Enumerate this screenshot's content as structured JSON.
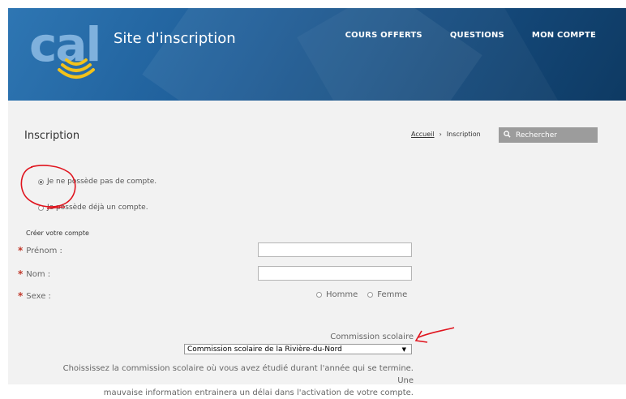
{
  "header": {
    "logo_text": "cal",
    "site_title": "Site d'inscription",
    "nav": [
      {
        "label": "COURS OFFERTS"
      },
      {
        "label": "QUESTIONS"
      },
      {
        "label": "MON COMPTE"
      }
    ]
  },
  "page": {
    "title": "Inscription",
    "breadcrumb": {
      "home": "Accueil",
      "separator": "›",
      "current": "Inscription"
    },
    "search_label": "Rechercher"
  },
  "account_choice": {
    "no_account": "Je ne possède pas de compte.",
    "has_account": "Je possède déjà un compte."
  },
  "form": {
    "section_title": "Créer votre compte",
    "required_mark": "*",
    "prenom_label": "Prénom :",
    "nom_label": "Nom :",
    "sexe_label": "Sexe :",
    "homme_label": "Homme",
    "femme_label": "Femme",
    "commission_label": "Commission scolaire",
    "commission_selected": "Commission scolaire de la Rivière-du-Nord",
    "help_line1": "Choississez la commission scolaire où vous avez étudié durant l'année qui se termine. Une",
    "help_line2": "mauvaise information entrainera un délai dans l'activation de votre compte."
  },
  "colors": {
    "header_blue": "#1f5f9a",
    "required_red": "#c0392b",
    "annotation_red": "#e0141e",
    "search_gray": "#9c9c9c"
  }
}
